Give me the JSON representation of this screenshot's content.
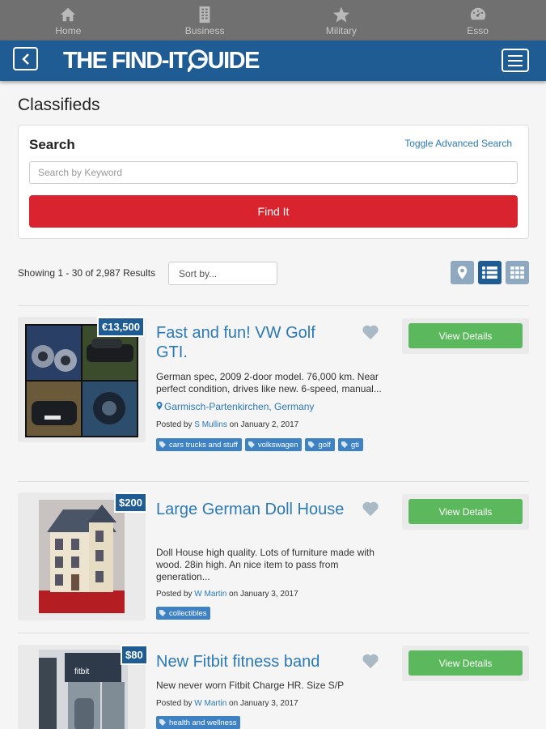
{
  "tabbar": {
    "tabs": [
      {
        "label": "Home",
        "icon": "home-icon"
      },
      {
        "label": "Business",
        "icon": "building-icon"
      },
      {
        "label": "Military",
        "icon": "star-icon"
      },
      {
        "label": "Esso",
        "icon": "gauge-icon"
      }
    ]
  },
  "header": {
    "logo_text_left": "THE FIND-IT",
    "logo_text_right": "UIDE",
    "colors": {
      "brand": "#1f5c94"
    }
  },
  "page": {
    "title": "Classifieds"
  },
  "search": {
    "label": "Search",
    "toggle_advanced": "Toggle Advanced Search",
    "placeholder": "Search by Keyword",
    "value": "",
    "submit": "Find It"
  },
  "results": {
    "count_text": "Showing 1 - 30 of 2,987 Results",
    "sort_value": "Sort by...",
    "views": [
      "map-view",
      "list-view",
      "grid-view"
    ],
    "active_view": "list-view"
  },
  "listings": [
    {
      "price": "€13,500",
      "title": "Fast and fun! VW Golf GTI.",
      "description": "German spec, 2009 2-door model. 76,000 km. Near perfect condition, drives like new. 6-speed, manual...",
      "location": "Garmisch-Partenkirchen, Germany",
      "posted_prefix": "Posted by",
      "author": "S Mullins",
      "date_text": "on January 2, 2017",
      "tags": [
        "cars trucks and stuff",
        "volkswagen",
        "golf",
        "gti"
      ],
      "button": "View Details"
    },
    {
      "price": "$200",
      "title": "Large German Doll House",
      "description": "Doll House high quality. Lots of furniture made with wood. 28in high. An nice item to pass from generation...",
      "location": "",
      "posted_prefix": "Posted by",
      "author": "W Martin",
      "date_text": "on January 3, 2017",
      "tags": [
        "collectibles"
      ],
      "button": "View Details"
    },
    {
      "price": "$80",
      "title": "New Fitbit fitness band",
      "description": "New never worn Fitbit Charge HR. Size S/P",
      "location": "",
      "posted_prefix": "Posted by",
      "author": "W Martin",
      "date_text": "on January 3, 2017",
      "tags": [
        "health and wellness"
      ],
      "thumb_text": "fitbit",
      "button": "View Details"
    }
  ]
}
